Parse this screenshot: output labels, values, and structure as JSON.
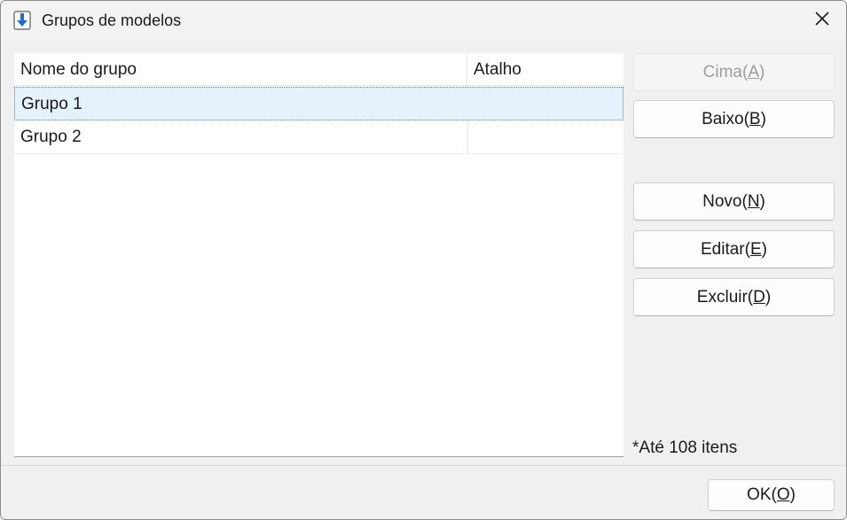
{
  "window": {
    "title": "Grupos de modelos",
    "icon": "download-arrow-icon"
  },
  "list": {
    "columns": [
      "Nome do grupo",
      "Atalho"
    ],
    "rows": [
      {
        "name": "Grupo 1",
        "shortcut": "",
        "selected": true
      },
      {
        "name": "Grupo 2",
        "shortcut": "",
        "selected": false
      }
    ]
  },
  "buttons": {
    "up": {
      "text": "Cima(",
      "key": "A",
      "suffix": ")",
      "enabled": false
    },
    "down": {
      "text": "Baixo(",
      "key": "B",
      "suffix": ")",
      "enabled": true
    },
    "new": {
      "text": "Novo(",
      "key": "N",
      "suffix": ")",
      "enabled": true
    },
    "edit": {
      "text": "Editar(",
      "key": "E",
      "suffix": ")",
      "enabled": true
    },
    "delete": {
      "text": "Excluir(",
      "key": "D",
      "suffix": ")",
      "enabled": true
    },
    "ok": {
      "text": "OK(",
      "key": "O",
      "suffix": ")",
      "enabled": true
    }
  },
  "note": "*Até 108 itens",
  "colors": {
    "selection": "#e5f1fb",
    "icon_blue": "#1e6fd0"
  }
}
